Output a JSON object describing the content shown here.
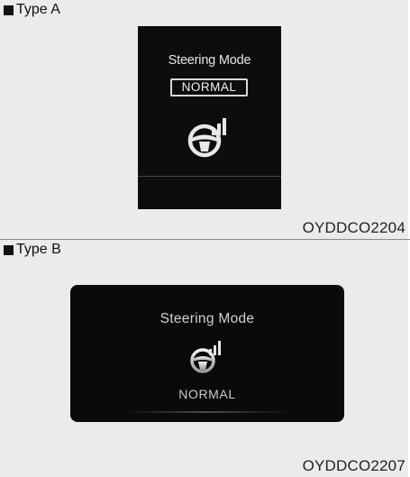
{
  "type_a": {
    "label": "Type A",
    "display": {
      "title": "Steering Mode",
      "mode": "NORMAL"
    },
    "code": "OYDDCO2204",
    "icon": "steering-wheel-icon"
  },
  "type_b": {
    "label": "Type B",
    "display": {
      "title": "Steering Mode",
      "mode": "NORMAL"
    },
    "code": "OYDDCO2207",
    "icon": "steering-wheel-icon"
  },
  "colors": {
    "panel_bg": "#ebebeb",
    "display_bg": "#0d0d0d",
    "display_text": "#e6e6e6"
  }
}
